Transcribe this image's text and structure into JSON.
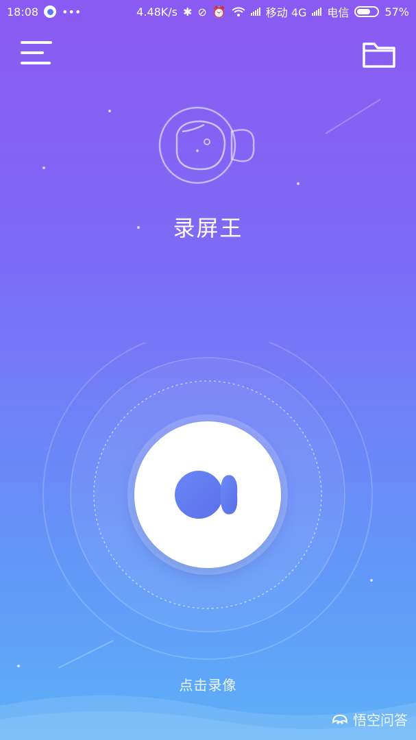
{
  "status_bar": {
    "time": "18:08",
    "more": "•••",
    "net_speed": "4.48K/s",
    "carrier1": "移动 4G",
    "carrier2": "电信",
    "battery": "57%",
    "battery_level": 0.57
  },
  "toolbar": {
    "menu_icon": "menu-icon",
    "folder_icon": "folder-icon"
  },
  "app": {
    "title": "录屏王",
    "logo_icon": "camera-logo-icon"
  },
  "record": {
    "button_icon": "record-camera-icon",
    "hint": "点击录像"
  },
  "watermark": {
    "text": "悟空问答",
    "icon": "wukong-logo-icon"
  },
  "colors": {
    "bg_top": "#8b5af2",
    "bg_bottom": "#5cb0f7",
    "accent": "#5a7bf0"
  }
}
